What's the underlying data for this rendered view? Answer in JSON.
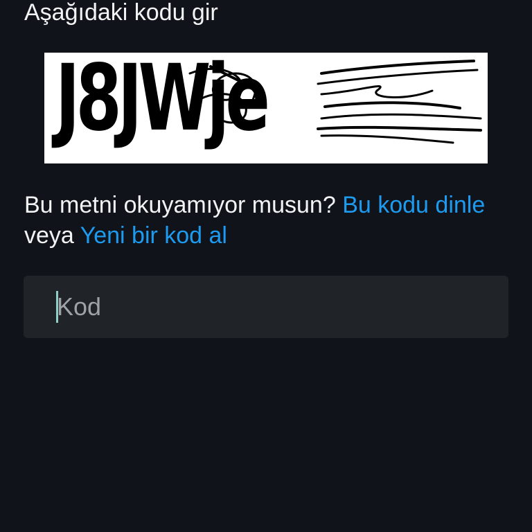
{
  "prompt": {
    "heading": "Aşağıdaki kodu gir"
  },
  "captcha": {
    "text": "J8JWje"
  },
  "help": {
    "question": "Bu metni okuyamıyor musun? ",
    "listen_link": "Bu kodu dinle",
    "or": " veya ",
    "new_code_link": "Yeni bir kod al"
  },
  "code_input": {
    "placeholder": "Kod",
    "value": ""
  },
  "colors": {
    "background": "#10141a",
    "text": "#f2f3f5",
    "link": "#1d9bf0",
    "input_background": "#202327",
    "placeholder": "#9ea3a8",
    "caret": "#8fcfc7"
  }
}
